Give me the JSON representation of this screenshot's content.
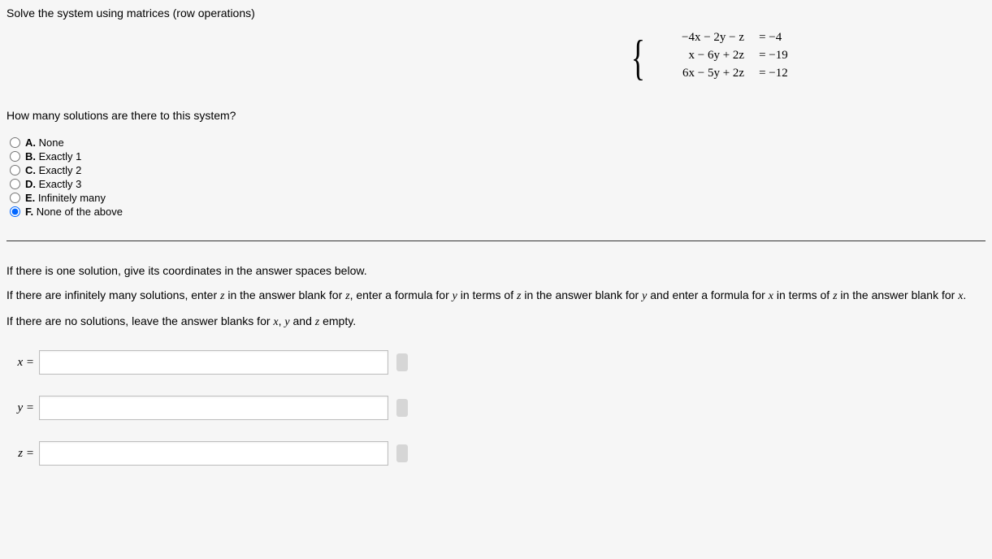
{
  "instruction": "Solve the system using matrices (row operations)",
  "equations": [
    {
      "lhs": "−4x − 2y − z",
      "rhs": "= −4"
    },
    {
      "lhs": "x − 6y + 2z",
      "rhs": "= −19"
    },
    {
      "lhs": "6x − 5y + 2z",
      "rhs": "= −12"
    }
  ],
  "question2": "How many solutions are there to this system?",
  "options": [
    {
      "letter": "A.",
      "text": "None"
    },
    {
      "letter": "B.",
      "text": "Exactly 1"
    },
    {
      "letter": "C.",
      "text": "Exactly 2"
    },
    {
      "letter": "D.",
      "text": "Exactly 3"
    },
    {
      "letter": "E.",
      "text": "Infinitely many"
    },
    {
      "letter": "F.",
      "text": "None of the above"
    }
  ],
  "selected_option": 5,
  "explain": {
    "p1_a": "If there is one solution, give its coordinates in the answer spaces below.",
    "p2_a": "If there are infinitely many solutions, enter ",
    "p2_b": " in the answer blank for ",
    "p2_c": ", enter a formula for ",
    "p2_d": " in terms of ",
    "p2_e": " in the answer blank for ",
    "p2_f": " and enter a formula for ",
    "p2_g": " in terms of ",
    "p2_h": " in the answer blank for ",
    "p2_i": ".",
    "p3_a": "If there are no solutions, leave the answer blanks for ",
    "p3_b": ", ",
    "p3_c": " and ",
    "p3_d": " empty."
  },
  "vars": {
    "x": "x",
    "y": "y",
    "z": "z"
  },
  "answers": {
    "x_label": "x =",
    "y_label": "y =",
    "z_label": "z =",
    "x_value": "",
    "y_value": "",
    "z_value": ""
  }
}
